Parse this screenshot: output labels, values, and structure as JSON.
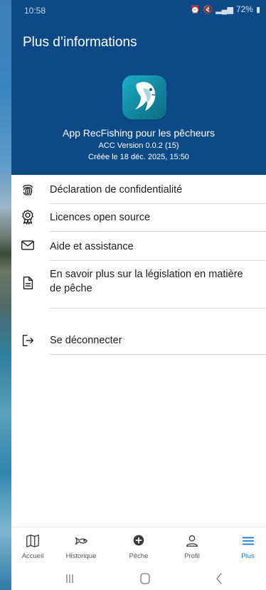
{
  "status_bar": {
    "time": "10:58",
    "battery": "72%"
  },
  "header": {
    "title": "Plus d’informations",
    "app_name": "App RecFishing pour les pêcheurs",
    "version": "ACC Version 0.0.2 (15)",
    "created": "Créée le 18 déc. 2025, 15:50"
  },
  "menu": {
    "items": [
      {
        "label": "Déclaration de confidentialité",
        "icon": "fingerprint-icon"
      },
      {
        "label": "Licences open source",
        "icon": "award-ribbon-icon"
      },
      {
        "label": "Aide et assistance",
        "icon": "mail-icon"
      },
      {
        "label": "En savoir plus sur la législation en matière de pêche",
        "icon": "document-icon"
      },
      {
        "label": "Se déconnecter",
        "icon": "logout-icon"
      }
    ]
  },
  "bottom_nav": {
    "items": [
      {
        "label": "Accueil",
        "icon": "map-icon"
      },
      {
        "label": "Historique",
        "icon": "fish-outline-icon"
      },
      {
        "label": "Pêche",
        "icon": "plus-circle-icon"
      },
      {
        "label": "Profil",
        "icon": "person-icon"
      },
      {
        "label": "Plus",
        "icon": "menu-icon",
        "active": true
      }
    ]
  },
  "colors": {
    "header_bg": "#0c4a87",
    "accent": "#1877d2",
    "logo_gradient_start": "#1bb0c9",
    "logo_gradient_end": "#0d6b85"
  }
}
